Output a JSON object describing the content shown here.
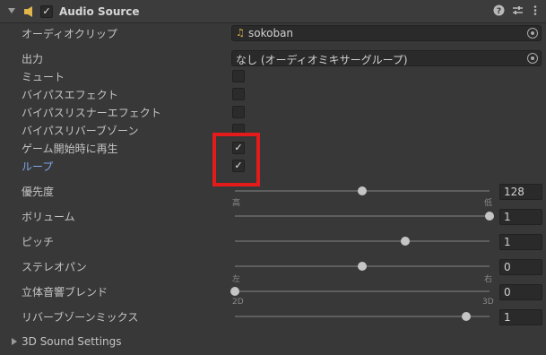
{
  "header": {
    "title": "Audio Source",
    "enabled": true,
    "help_icon": "help-icon",
    "preset_icon": "preset-sliders-icon",
    "menu_icon": "kebab-menu-icon",
    "icon": "speaker-icon"
  },
  "rows": {
    "audio_clip": {
      "label": "オーディオクリップ",
      "value": "sokoban",
      "icon": "music-note-icon"
    },
    "output": {
      "label": "出力",
      "value": "なし (オーディオミキサーグループ)"
    },
    "mute": {
      "label": "ミュート",
      "checked": false
    },
    "bypass_effects": {
      "label": "バイパスエフェクト",
      "checked": false
    },
    "bypass_listener": {
      "label": "バイパスリスナーエフェクト",
      "checked": false
    },
    "bypass_reverb": {
      "label": "バイパスリバーブゾーン",
      "checked": false
    },
    "play_on_awake": {
      "label": "ゲーム開始時に再生",
      "checked": true
    },
    "loop": {
      "label": "ループ",
      "checked": true
    }
  },
  "sliders": {
    "priority": {
      "label": "優先度",
      "value": "128",
      "fraction": 0.5,
      "min_label": "高",
      "max_label": "低"
    },
    "volume": {
      "label": "ボリューム",
      "value": "1",
      "fraction": 1.0
    },
    "pitch": {
      "label": "ピッチ",
      "value": "1",
      "fraction": 0.67
    },
    "stereo_pan": {
      "label": "ステレオパン",
      "value": "0",
      "fraction": 0.5,
      "min_label": "左",
      "max_label": "右"
    },
    "spatial_blend": {
      "label": "立体音響ブレンド",
      "value": "0",
      "fraction": 0.0,
      "min_label": "2D",
      "max_label": "3D"
    },
    "reverb_zone_mix": {
      "label": "リバーブゾーンミックス",
      "value": "1",
      "fraction": 0.91
    }
  },
  "footer": {
    "label": "3D Sound Settings"
  },
  "colors": {
    "highlight": "#e31b1b",
    "loop_label": "#7ea5e8"
  }
}
